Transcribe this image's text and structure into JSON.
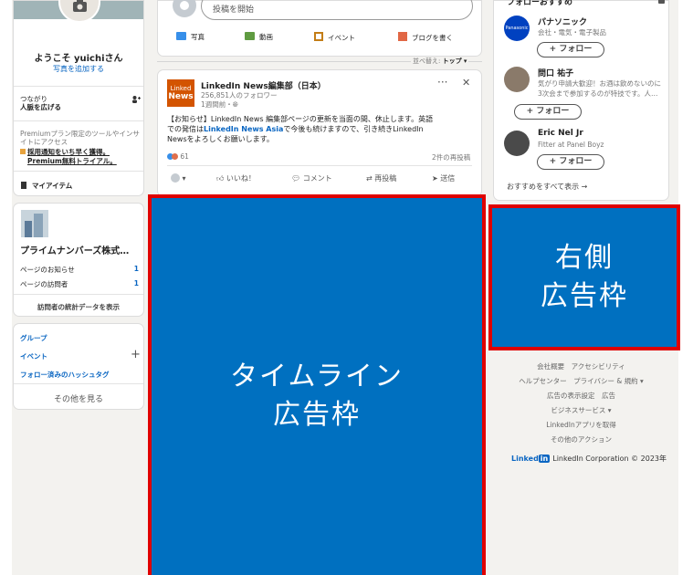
{
  "colors": {
    "linkedin_blue": "#0a66c2",
    "ad_blue": "#0070c0",
    "ad_border": "#e00000"
  },
  "left": {
    "welcome": "ようこそ yuichiさん",
    "add_photo": "写真を追加する",
    "connections_label": "つながり",
    "connections_sub": "人脈を広げる",
    "premium_text": "Premiumプラン限定のツールやインサイトにアクセス",
    "premium_link1": "採用通知をいち早く獲得。",
    "premium_link2": "Premium無料トライアル。",
    "my_items": "マイアイテム",
    "company_name": "プライムナンバーズ株式…",
    "page_notifications": "ページのお知らせ",
    "page_notifications_count": "1",
    "page_visitors": "ページの訪問者",
    "page_visitors_count": "1",
    "visitor_stats": "訪問者の統計データを表示",
    "groups": "グループ",
    "events": "イベント",
    "hashtags": "フォロー済みのハッシュタグ",
    "see_more": "その他を見る"
  },
  "composer": {
    "placeholder": "投稿を開始",
    "photo": "写真",
    "video": "動画",
    "event": "イベント",
    "article": "ブログを書く",
    "sort_label": "並べ替え:",
    "sort_value": "トップ"
  },
  "news_post": {
    "author": "LinkedIn News編集部（日本）",
    "followers": "256,851人のフォロワー",
    "time": "1週間前・",
    "logo_line1": "Linked",
    "logo_line2": "News",
    "body_line1": "【お知らせ】LinkedIn News 編集部ページの更新を当面の間、休止します。英語",
    "body_line2a": "での発信は",
    "body_line2_link": "LinkedIn News Asia",
    "body_line2b": "で今後も続けますので、引き続きLinkedIn",
    "body_line3": "Newsをよろしくお願いします。",
    "reaction_count": "61",
    "repost_count": "2件の再投稿",
    "like": "いいね！",
    "comment": "コメント",
    "repost": "再投稿",
    "send": "送信"
  },
  "ads": {
    "timeline_line1": "タイムライン",
    "timeline_line2": "広告枠",
    "right_line1": "右側",
    "right_line2": "広告枠"
  },
  "reco": {
    "title": "フォローおすすめ",
    "items": [
      {
        "name": "パナソニック",
        "sub1": "会社・電気・電子製品",
        "sub2": ""
      },
      {
        "name": "問口 祐子",
        "sub1": "気がり申請大歓迎！お酒は飲めないのに",
        "sub2": "3次会まで参加するのが特技です。人…"
      },
      {
        "name": "Eric Nel Jr",
        "sub1": "Fitter at Panel Boyz",
        "sub2": ""
      }
    ],
    "follow_label": "+ フォロー",
    "see_all": "おすすめをすべて表示 →",
    "panasonic_logo": "Panasonic"
  },
  "footer": {
    "links": [
      "会社概要　アクセシビリティ",
      "ヘルプセンター　プライバシー & 規約 ▾",
      "広告の表示設定　広告",
      "ビジネスサービス ▾",
      "LinkedInアプリを取得",
      "その他のアクション"
    ],
    "brand": "Linked",
    "brand_in": "in",
    "copyright": "LinkedIn Corporation © 2023年"
  }
}
